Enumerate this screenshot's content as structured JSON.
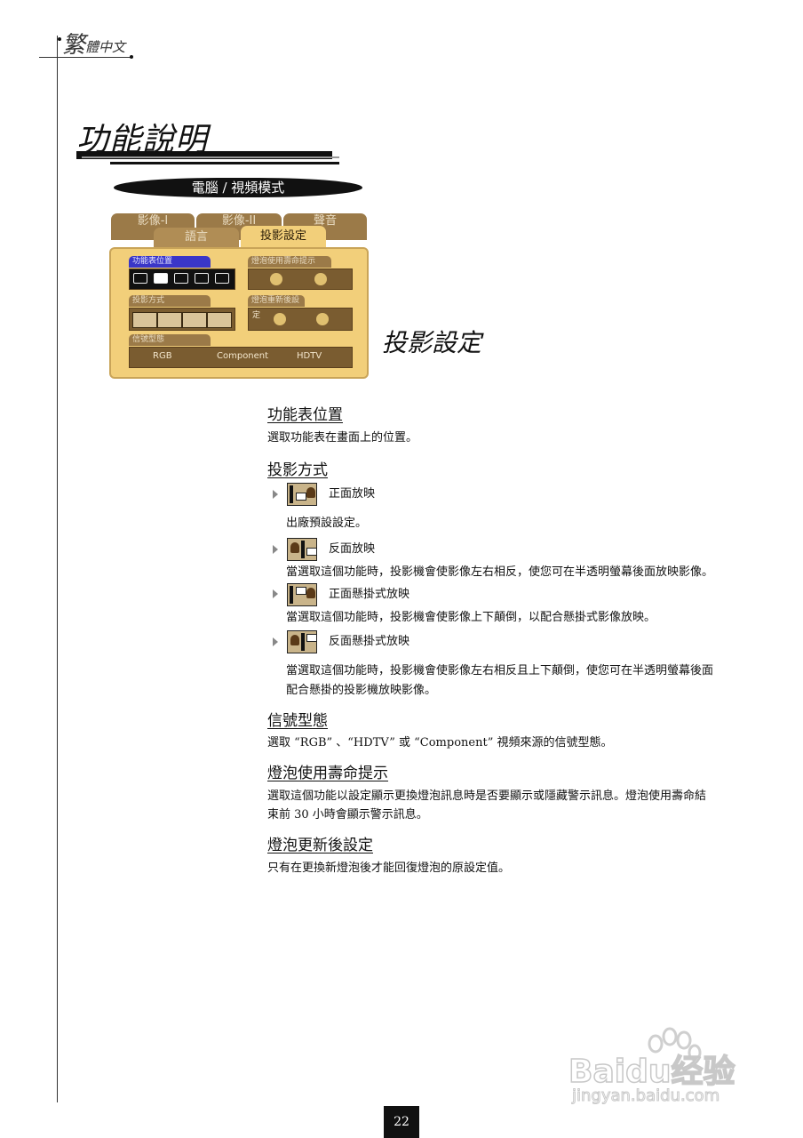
{
  "header": {
    "lang_big": "繁",
    "lang_small": "體中文"
  },
  "title": "功能說明",
  "mode_banner": "電腦 / 視頻模式",
  "osd": {
    "tabs_back": [
      "影像-I",
      "影像-II",
      "聲音"
    ],
    "tab_lang": "語言",
    "tab_active": "投影設定",
    "menu_position_label": "功能表位置",
    "projection_label": "投影方式",
    "signal_label": "信號型態",
    "signal_options": [
      "RGB",
      "Component",
      "HDTV"
    ],
    "lamp_reminder_label": "燈泡使用壽命提示",
    "lamp_reset_label": "燈泡重新後設",
    "lamp_reset_label2": "定"
  },
  "osd_caption": "投影設定",
  "sections": {
    "menu_position": {
      "heading": "功能表位置",
      "text": "選取功能表在畫面上的位置。"
    },
    "projection": {
      "heading": "投影方式",
      "items": [
        {
          "label": "正面放映",
          "desc": "出廠預設設定。"
        },
        {
          "label": "反面放映",
          "desc": "當選取這個功能時，投影機會使影像左右相反，使您可在半透明螢幕後面放映影像。"
        },
        {
          "label": "正面懸掛式放映",
          "desc": "當選取這個功能時，投影機會使影像上下顛倒，以配合懸掛式影像放映。"
        },
        {
          "label": "反面懸掛式放映",
          "desc": "當選取這個功能時，投影機會使影像左右相反且上下顛倒，使您可在半透明螢幕後面",
          "desc2": "配合懸掛的投影機放映影像。"
        }
      ]
    },
    "signal_type": {
      "heading": "信號型態",
      "text": "選取 “RGB” 、“HDTV” 或 “Component” 視頻來源的信號型態。"
    },
    "lamp_reminder": {
      "heading": "燈泡使用壽命提示",
      "text": "選取這個功能以設定顯示更換燈泡訊息時是否要顯示或隱藏警示訊息。燈泡使用壽命結",
      "text2": "束前 30 小時會顯示警示訊息。"
    },
    "lamp_reset": {
      "heading": "燈泡更新後設定",
      "text": "只有在更換新燈泡後才能回復燈泡的原設定值。"
    }
  },
  "page_number": "22",
  "watermark": {
    "brand": "Baidu经验",
    "url": "jingyan.baidu.com"
  }
}
